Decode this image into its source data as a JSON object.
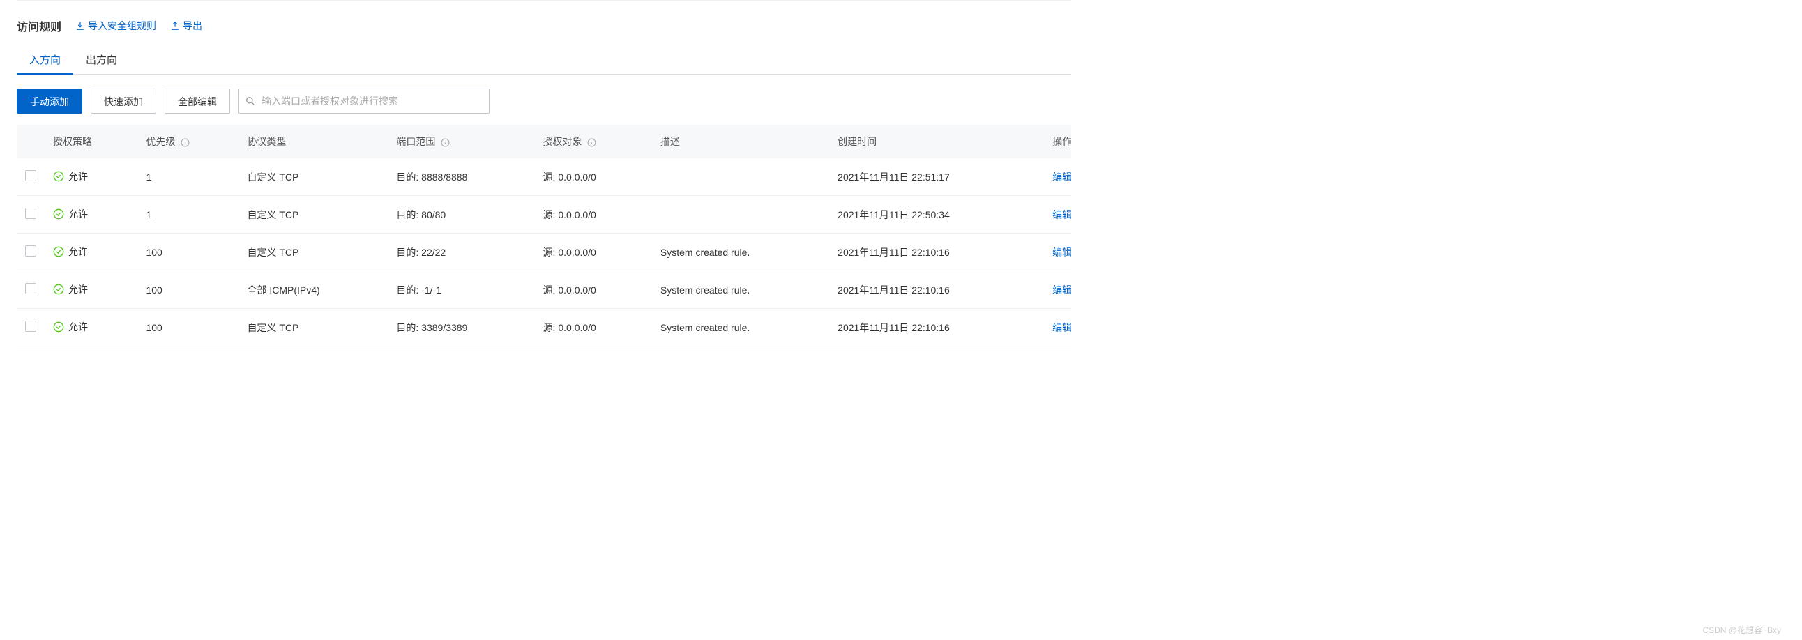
{
  "header": {
    "title": "访问规则",
    "import_label": "导入安全组规则",
    "export_label": "导出"
  },
  "tabs": {
    "inbound": "入方向",
    "outbound": "出方向"
  },
  "toolbar": {
    "manual_add": "手动添加",
    "quick_add": "快速添加",
    "edit_all": "全部编辑",
    "search_placeholder": "输入端口或者授权对象进行搜索"
  },
  "columns": {
    "policy": "授权策略",
    "priority": "优先级",
    "protocol": "协议类型",
    "port_range": "端口范围",
    "auth_object": "授权对象",
    "description": "描述",
    "create_time": "创建时间",
    "actions": "操作"
  },
  "status": {
    "allow": "允许"
  },
  "action_labels": {
    "edit": "编辑"
  },
  "rows": [
    {
      "policy_key": "allow",
      "priority": "1",
      "protocol": "自定义 TCP",
      "port_range": "目的: 8888/8888",
      "auth_object": "源: 0.0.0.0/0",
      "description": "",
      "create_time": "2021年11月11日 22:51:17"
    },
    {
      "policy_key": "allow",
      "priority": "1",
      "protocol": "自定义 TCP",
      "port_range": "目的: 80/80",
      "auth_object": "源: 0.0.0.0/0",
      "description": "",
      "create_time": "2021年11月11日 22:50:34"
    },
    {
      "policy_key": "allow",
      "priority": "100",
      "protocol": "自定义 TCP",
      "port_range": "目的: 22/22",
      "auth_object": "源: 0.0.0.0/0",
      "description": "System created rule.",
      "create_time": "2021年11月11日 22:10:16"
    },
    {
      "policy_key": "allow",
      "priority": "100",
      "protocol": "全部 ICMP(IPv4)",
      "port_range": "目的: -1/-1",
      "auth_object": "源: 0.0.0.0/0",
      "description": "System created rule.",
      "create_time": "2021年11月11日 22:10:16"
    },
    {
      "policy_key": "allow",
      "priority": "100",
      "protocol": "自定义 TCP",
      "port_range": "目的: 3389/3389",
      "auth_object": "源: 0.0.0.0/0",
      "description": "System created rule.",
      "create_time": "2021年11月11日 22:10:16"
    }
  ],
  "watermark": "CSDN @花想容~Bxy"
}
